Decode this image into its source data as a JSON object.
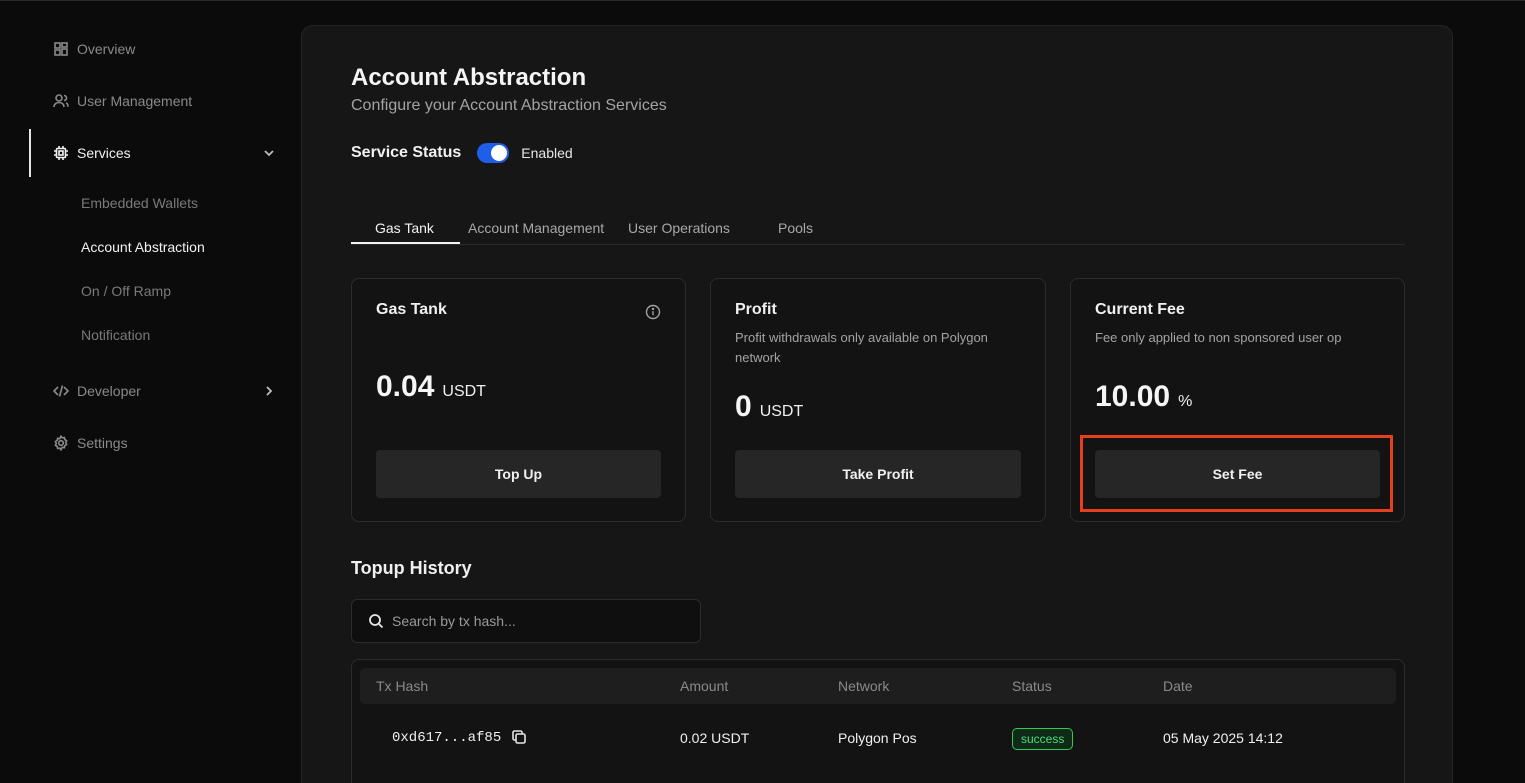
{
  "sidebar": {
    "items": [
      {
        "label": "Overview",
        "icon": "grid-icon"
      },
      {
        "label": "User Management",
        "icon": "user-icon"
      },
      {
        "label": "Services",
        "icon": "chip-icon",
        "expanded": true
      },
      {
        "label": "Developer",
        "icon": "code-icon"
      },
      {
        "label": "Settings",
        "icon": "gear-icon"
      }
    ],
    "services_sub": [
      "Embedded Wallets",
      "Account Abstraction",
      "On / Off Ramp",
      "Notification"
    ],
    "active_sub": "Account Abstraction"
  },
  "page": {
    "title": "Account Abstraction",
    "subtitle": "Configure your Account Abstraction Services"
  },
  "service_status": {
    "label": "Service Status",
    "value": "Enabled",
    "enabled": true,
    "toggle_color": "#1f5ee8"
  },
  "tabs": [
    "Gas Tank",
    "Account Management",
    "User Operations",
    "Pools"
  ],
  "active_tab": "Gas Tank",
  "cards": {
    "gas_tank": {
      "title": "Gas Tank",
      "value": "0.04",
      "unit": "USDT",
      "button": "Top Up"
    },
    "profit": {
      "title": "Profit",
      "description": "Profit withdrawals only available on Polygon network",
      "value": "0",
      "unit": "USDT",
      "button": "Take Profit"
    },
    "current_fee": {
      "title": "Current Fee",
      "description": "Fee only applied to non sponsored user op",
      "value": "10.00",
      "unit": "%",
      "button": "Set Fee"
    }
  },
  "highlight_color": "#e5401d",
  "topup_history": {
    "title": "Topup History",
    "search_placeholder": "Search by tx hash...",
    "columns": [
      "Tx Hash",
      "Amount",
      "Network",
      "Status",
      "Date"
    ],
    "rows": [
      {
        "tx_hash": "0xd617...af85",
        "amount": "0.02 USDT",
        "network": "Polygon Pos",
        "status": "success",
        "date": "05 May 2025 14:12"
      }
    ],
    "status_color": "#4ade80"
  }
}
